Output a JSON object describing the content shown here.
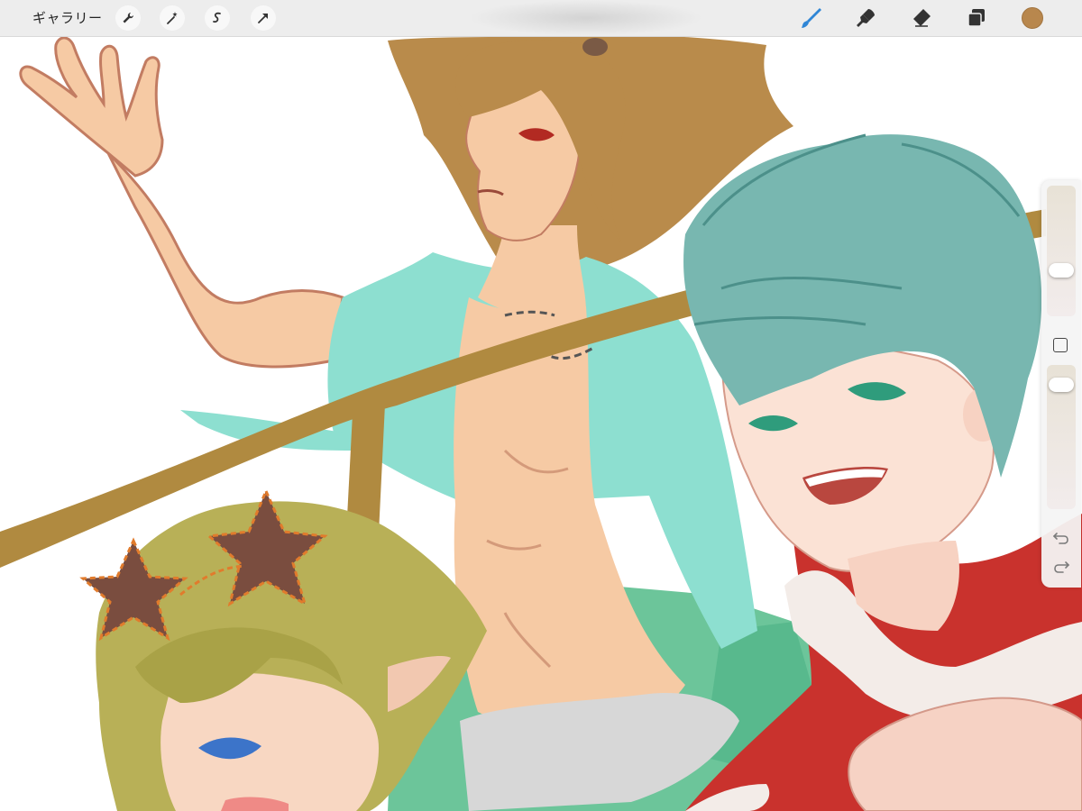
{
  "toolbar": {
    "gallery_label": "ギャラリー",
    "left_tools": [
      "wrench-icon",
      "magic-wand-icon",
      "selection-icon",
      "transform-arrow-icon"
    ],
    "right_tools": [
      "brush-icon",
      "smudge-icon",
      "eraser-icon",
      "layers-icon",
      "color-swatch"
    ],
    "active_tool": "brush-icon",
    "accent_color": "#2f86d6",
    "current_color": "#b8874d"
  },
  "sidepanel": {
    "brush_size_level": 0.45,
    "opacity_level": 0.95,
    "controls": [
      "brush-size-slider",
      "modify-button",
      "opacity-slider",
      "undo-button",
      "redo-button"
    ]
  },
  "canvas": {
    "content": "anime-style-illustration",
    "colors": {
      "skin": "#f6caa4",
      "skin_line": "#c27c62",
      "brown_hair": "#b98b4b",
      "teal_hair": "#78b7b0",
      "cyan_shirt": "#8ddfd0",
      "blonde_hair": "#b8b057",
      "star": "#7a4d3f",
      "rail": "#b08a40",
      "red_coat": "#c9322d",
      "fur": "#f3ece8",
      "green_bg": "#6cc59a",
      "gray_cloth": "#d7d7d7"
    }
  }
}
